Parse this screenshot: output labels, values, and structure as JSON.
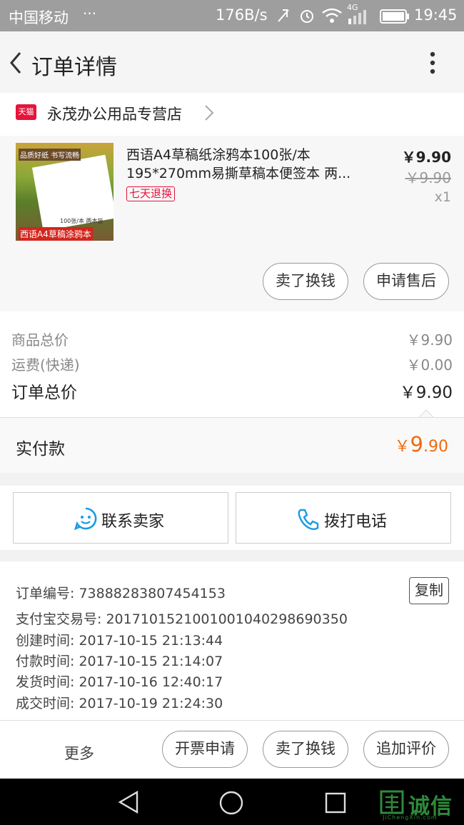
{
  "status_bar": {
    "carrier": "中国移动",
    "dots": "···",
    "net_speed": "176B/s",
    "network": "4G",
    "time": "19:45"
  },
  "header": {
    "title": "订单详情"
  },
  "store": {
    "badge": "天猫",
    "name": "永茂办公用品专营店"
  },
  "product": {
    "image_texts": [
      "品质好纸 书写流畅",
      "100张/本 两本装",
      "西语A4草稿涂鸦本"
    ],
    "title": "西语A4草稿纸涂鸦本100张/本 195*270mm易撕草稿本便签本 两...",
    "tag": "七天退换",
    "price": "￥9.90",
    "original_price": "￥9.90",
    "quantity": "x1",
    "actions": [
      "卖了换钱",
      "申请售后"
    ]
  },
  "summary": {
    "rows": [
      {
        "label": "商品总价",
        "value": "￥9.90"
      },
      {
        "label": "运费(快递)",
        "value": "￥0.00"
      },
      {
        "label": "订单总价",
        "value": "￥9.90"
      }
    ],
    "paid_label": "实付款",
    "paid_currency": "￥",
    "paid_integer": "9",
    "paid_decimal": ".90"
  },
  "contact": {
    "seller_label": "联系卖家",
    "call_label": "拨打电话"
  },
  "order_info": {
    "copy_label": "复制",
    "lines": [
      "订单编号: 73888283807454153",
      "支付宝交易号: 2017101521001001040298690350",
      "创建时间: 2017-10-15 21:13:44",
      "付款时间: 2017-10-15 21:14:07",
      "发货时间: 2017-10-16 12:40:17",
      "成交时间: 2017-10-19 21:24:30"
    ]
  },
  "bottom_bar": {
    "more": "更多",
    "buttons": [
      "开票申请",
      "卖了换钱",
      "追加评价"
    ]
  },
  "watermark": {
    "text": "诚信",
    "sub": "JiChengXin.com"
  },
  "colors": {
    "accent_orange": "#f26a10",
    "tmall_red": "#e5143c",
    "icon_blue": "#1a9be6"
  }
}
